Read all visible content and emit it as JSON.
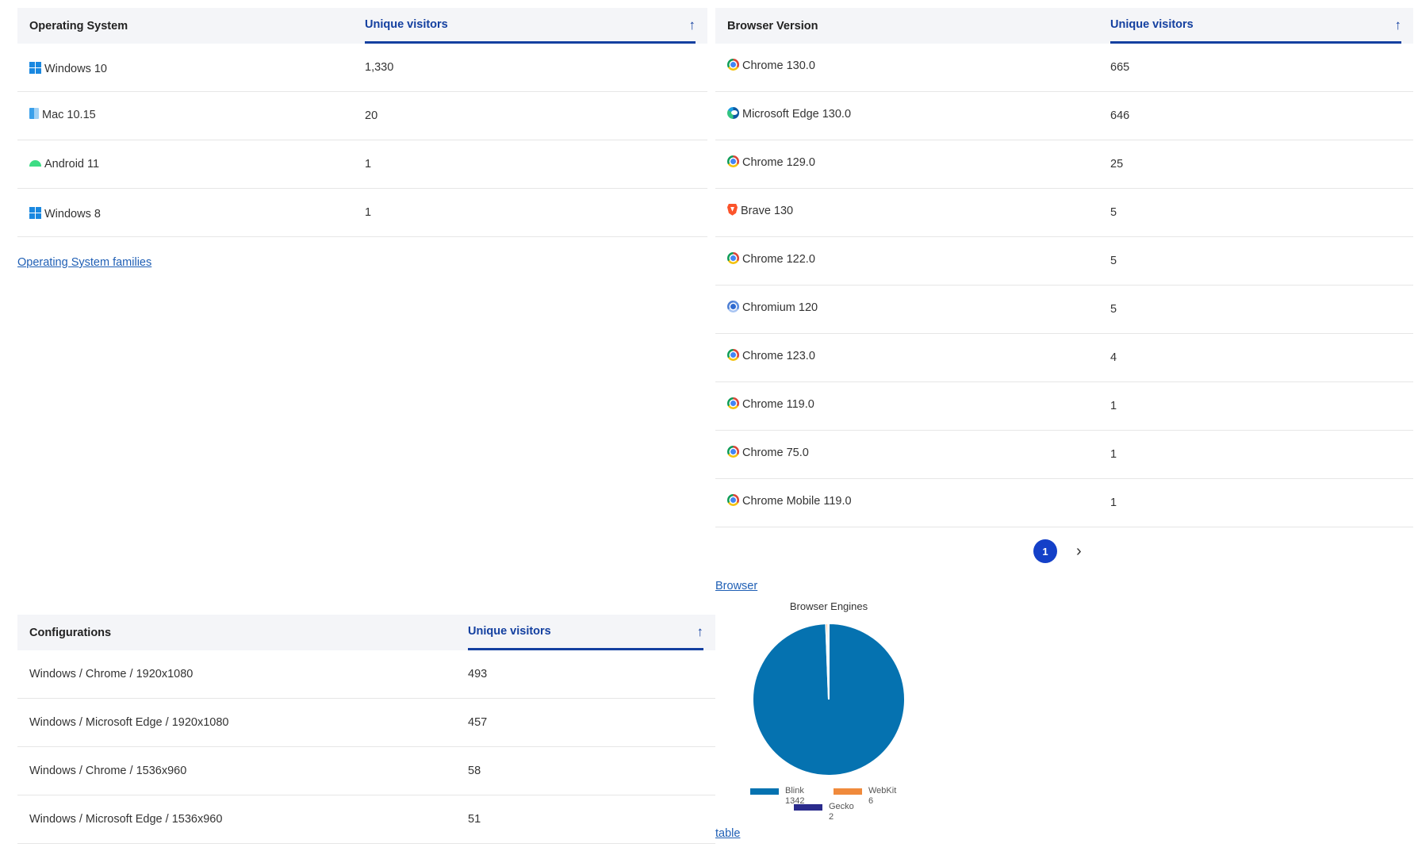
{
  "os_table": {
    "header_label": "Operating System",
    "header_metric": "Unique visitors",
    "sort_icon": "arrow-up-icon",
    "rows": [
      {
        "icon": "windows-icon",
        "label": "Windows 10",
        "value": "1,330"
      },
      {
        "icon": "mac-icon",
        "label": "Mac 10.15",
        "value": "20"
      },
      {
        "icon": "android-icon",
        "label": "Android 11",
        "value": "1"
      },
      {
        "icon": "windows-icon",
        "label": "Windows 8",
        "value": "1"
      }
    ],
    "footer_link": "Operating System families"
  },
  "browser_table": {
    "header_label": "Browser Version",
    "header_metric": "Unique visitors",
    "sort_icon": "arrow-up-icon",
    "rows": [
      {
        "icon": "chrome-icon",
        "label": "Chrome 130.0",
        "value": "665"
      },
      {
        "icon": "edge-icon",
        "label": "Microsoft Edge 130.0",
        "value": "646"
      },
      {
        "icon": "chrome-icon",
        "label": "Chrome 129.0",
        "value": "25"
      },
      {
        "icon": "brave-icon",
        "label": "Brave 130",
        "value": "5"
      },
      {
        "icon": "chrome-icon",
        "label": "Chrome 122.0",
        "value": "5"
      },
      {
        "icon": "chromium-icon",
        "label": "Chromium 120",
        "value": "5"
      },
      {
        "icon": "chrome-icon",
        "label": "Chrome 123.0",
        "value": "4"
      },
      {
        "icon": "chrome-icon",
        "label": "Chrome 119.0",
        "value": "1"
      },
      {
        "icon": "chrome-icon",
        "label": "Chrome 75.0",
        "value": "1"
      },
      {
        "icon": "chrome-icon",
        "label": "Chrome Mobile 119.0",
        "value": "1"
      }
    ],
    "pagination": {
      "current_page": "1",
      "next_icon": "chevron-right-icon"
    },
    "footer_link": "Browser"
  },
  "config_table": {
    "header_label": "Configurations",
    "header_metric": "Unique visitors",
    "sort_icon": "arrow-up-icon",
    "rows": [
      {
        "label": "Windows / Chrome / 1920x1080",
        "value": "493"
      },
      {
        "label": "Windows / Microsoft Edge / 1920x1080",
        "value": "457"
      },
      {
        "label": "Windows / Chrome / 1536x960",
        "value": "58"
      },
      {
        "label": "Windows / Microsoft Edge / 1536x960",
        "value": "51"
      }
    ]
  },
  "chart_data": {
    "type": "pie",
    "title": "Browser Engines",
    "categories": [
      "Blink",
      "WebKit",
      "Gecko"
    ],
    "values": [
      1342,
      6,
      2
    ],
    "colors": [
      "#0572b0",
      "#f08a3c",
      "#2a2b8c"
    ],
    "value_labels": [
      "1342",
      "6",
      "2"
    ],
    "legend_position": "bottom"
  },
  "table_link": "table",
  "colors": {
    "accent": "#1440a0",
    "pager_active": "#1440c8",
    "link": "#1f5fb5",
    "header_bg": "#f4f5f8"
  }
}
